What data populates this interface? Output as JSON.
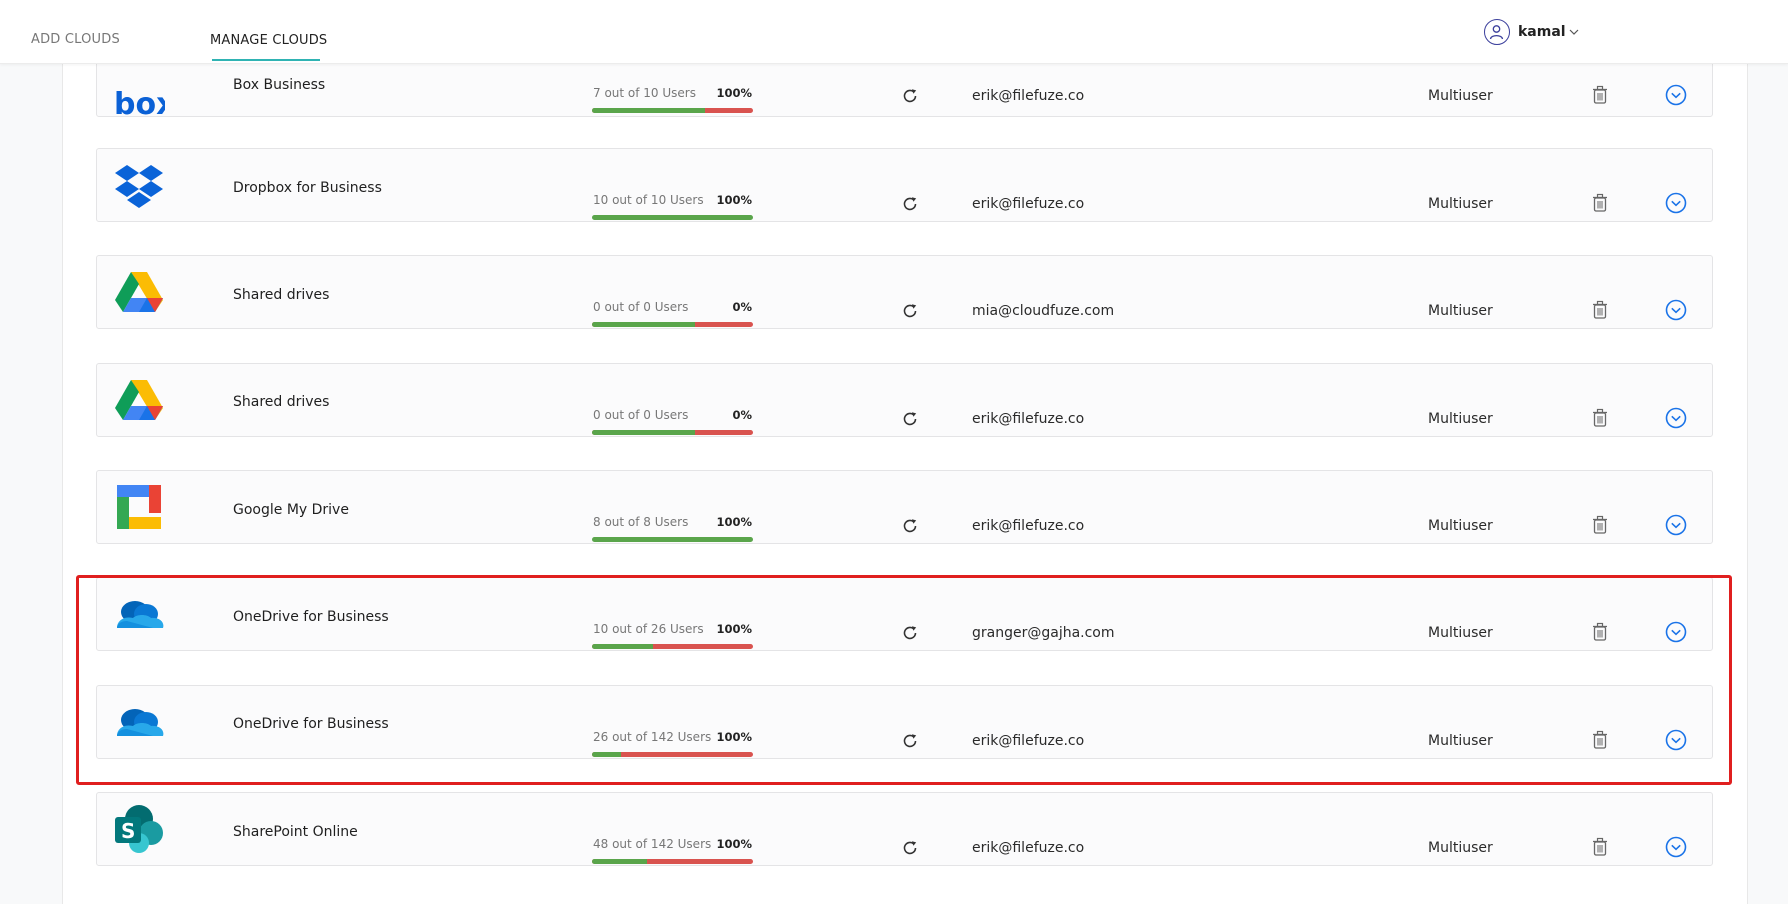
{
  "nav": {
    "tabs": [
      {
        "label": "ADD CLOUDS"
      },
      {
        "label": "MANAGE CLOUDS"
      }
    ],
    "user": {
      "name": "kamal"
    }
  },
  "colors": {
    "accent_underline": "#2fb3b3",
    "bar_green": "#5aa54b",
    "bar_red": "#d9534f",
    "highlight_box": "#e01f1f",
    "chevron_blue": "#1a73e8"
  },
  "clouds": [
    {
      "name": "Box Business",
      "logo": "box-logo",
      "users": "7 out of 10 Users",
      "usage_fraction": 0.7,
      "percent": "100%",
      "email": "erik@filefuze.co",
      "type": "Multiuser"
    },
    {
      "name": "Dropbox for Business",
      "logo": "dropbox-logo",
      "users": "10 out of 10 Users",
      "usage_fraction": 1.0,
      "percent": "100%",
      "email": "erik@filefuze.co",
      "type": "Multiuser"
    },
    {
      "name": "Shared drives",
      "logo": "google-drive-logo",
      "users": "0 out of 0 Users",
      "usage_fraction": 0.64,
      "percent": "0%",
      "email": "mia@cloudfuze.com",
      "type": "Multiuser"
    },
    {
      "name": "Shared drives",
      "logo": "google-drive-logo",
      "users": "0 out of 0 Users",
      "usage_fraction": 0.64,
      "percent": "0%",
      "email": "erik@filefuze.co",
      "type": "Multiuser"
    },
    {
      "name": "Google My Drive",
      "logo": "google-workspace-logo",
      "users": "8 out of 8 Users",
      "usage_fraction": 1.0,
      "percent": "100%",
      "email": "erik@filefuze.co",
      "type": "Multiuser"
    },
    {
      "name": "OneDrive for Business",
      "logo": "onedrive-logo",
      "users": "10 out of 26 Users",
      "usage_fraction": 0.38,
      "percent": "100%",
      "email": "granger@gajha.com",
      "type": "Multiuser"
    },
    {
      "name": "OneDrive for Business",
      "logo": "onedrive-logo",
      "users": "26 out of 142 Users",
      "usage_fraction": 0.18,
      "percent": "100%",
      "email": "erik@filefuze.co",
      "type": "Multiuser"
    },
    {
      "name": "SharePoint Online",
      "logo": "sharepoint-logo",
      "users": "48 out of 142 Users",
      "usage_fraction": 0.34,
      "percent": "100%",
      "email": "erik@filefuze.co",
      "type": "Multiuser"
    }
  ]
}
